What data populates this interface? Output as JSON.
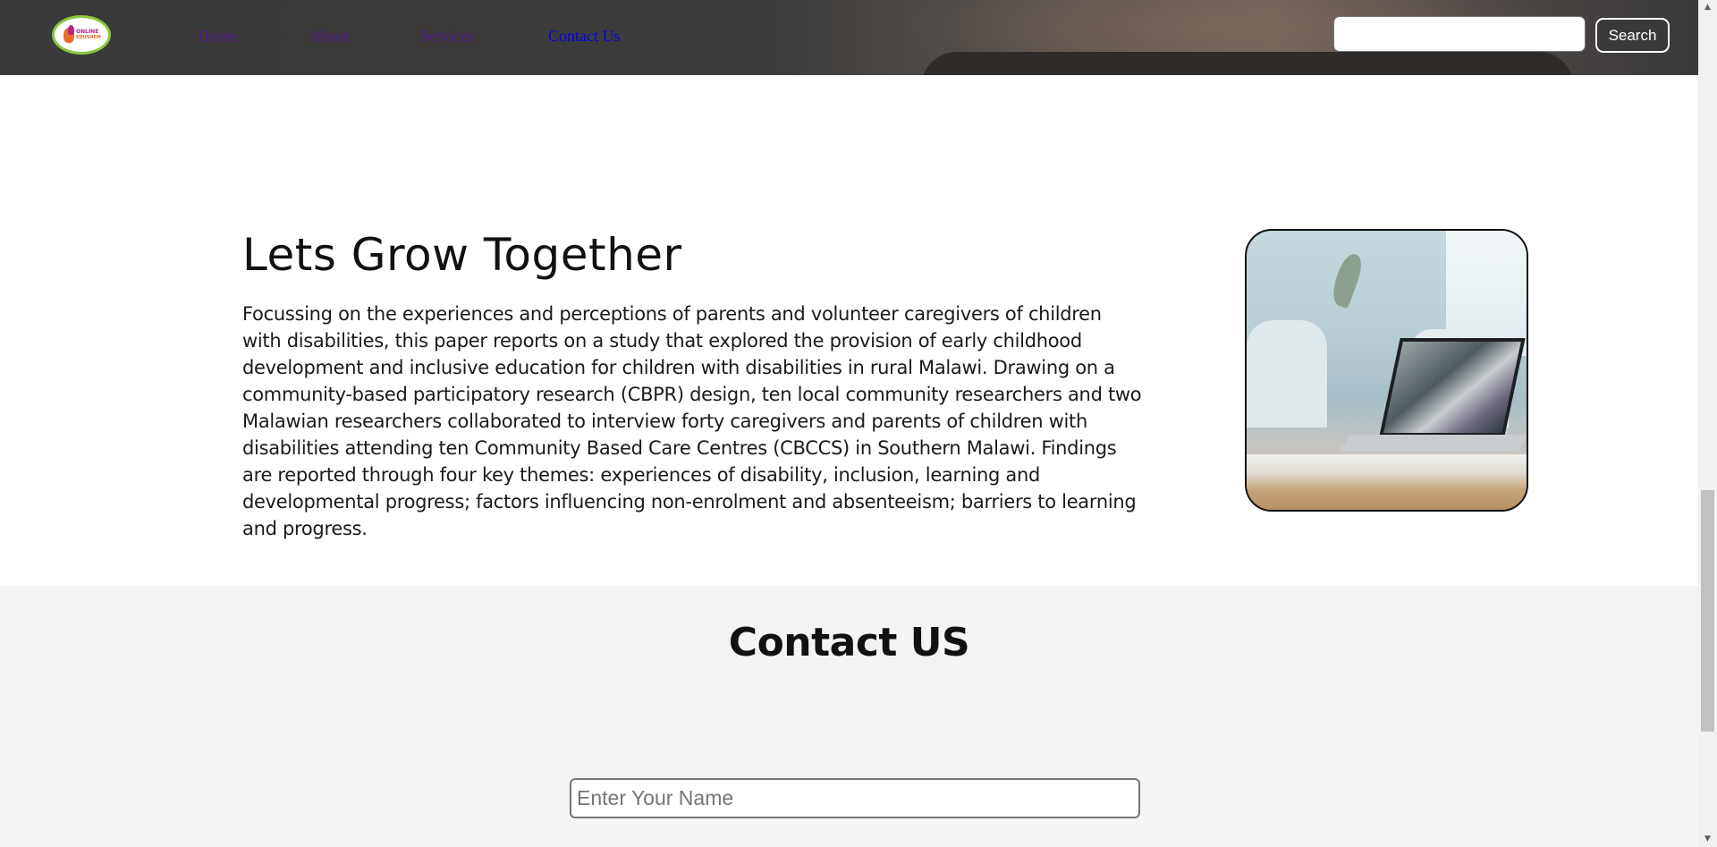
{
  "header": {
    "logo_line1": "ONLINE",
    "logo_line2": "EDUSHEM",
    "nav": [
      "Home",
      "About",
      "Services",
      "Contact Us"
    ],
    "search_button": "Search",
    "search_value": ""
  },
  "about": {
    "title": "Lets Grow Together",
    "body": "Focussing on the experiences and perceptions of parents and volunteer caregivers of children with disabilities, this paper reports on a study that explored the provision of early childhood development and inclusive education for children with disabilities in rural Malawi. Drawing on a community-based participatory research (CBPR) design, ten local community researchers and two Malawian researchers collaborated to interview forty caregivers and parents of children with disabilities attending ten Community Based Care Centres (CBCCS) in Southern Malawi. Findings are reported through four key themes: experiences of disability, inclusion, learning and developmental progress; factors influencing non-enrolment and absenteeism; barriers to learning and progress."
  },
  "contact": {
    "title": "Contact US",
    "name_placeholder": "Enter Your Name"
  },
  "colors": {
    "visited_link": "#551a8b",
    "active_link": "#0000ee",
    "logo_ring": "#8cc63f",
    "contact_bg": "#f5f4f2"
  },
  "icons": {
    "scroll_up": "triangle-up",
    "scroll_down": "triangle-down"
  }
}
